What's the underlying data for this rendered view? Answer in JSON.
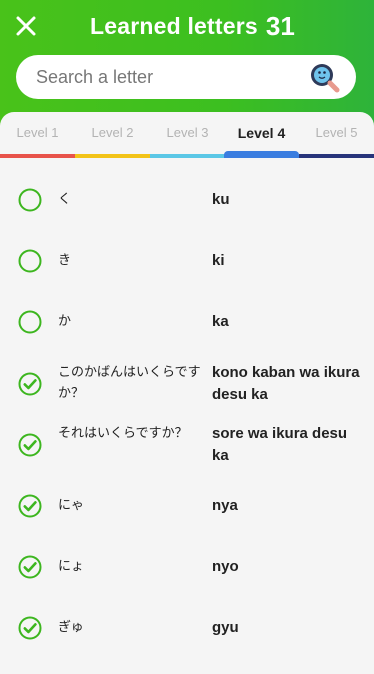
{
  "header": {
    "title": "Learned letters",
    "count": "31"
  },
  "search": {
    "placeholder": "Search a letter"
  },
  "tabs": [
    {
      "label": "Level 1",
      "color": "#e8534a"
    },
    {
      "label": "Level 2",
      "color": "#f2c318"
    },
    {
      "label": "Level 3",
      "color": "#5bc7e6"
    },
    {
      "label": "Level 4",
      "color": "#3a7de0"
    },
    {
      "label": "Level 5",
      "color": "#27347a"
    }
  ],
  "active_tab": "Level 4",
  "letters": [
    {
      "kana": "く",
      "romaji": "ku",
      "learned": false
    },
    {
      "kana": "き",
      "romaji": "ki",
      "learned": false
    },
    {
      "kana": "か",
      "romaji": "ka",
      "learned": false
    },
    {
      "kana": "このかばんはいくらですか？",
      "romaji": "kono kaban wa ikura desu ka",
      "learned": true
    },
    {
      "kana": "それはいくらですか？",
      "romaji": "sore wa ikura desu ka",
      "learned": true
    },
    {
      "kana": "にゃ",
      "romaji": "nya",
      "learned": true
    },
    {
      "kana": "にょ",
      "romaji": "nyo",
      "learned": true
    },
    {
      "kana": "ぎゅ",
      "romaji": "gyu",
      "learned": true
    }
  ],
  "icons": {
    "close": "close-icon",
    "search": "search-magnifier-icon",
    "unchecked": "circle-outline-icon",
    "checked": "check-circle-icon"
  },
  "colors": {
    "header_green": "#45c01c",
    "check_green": "#3db61f"
  }
}
